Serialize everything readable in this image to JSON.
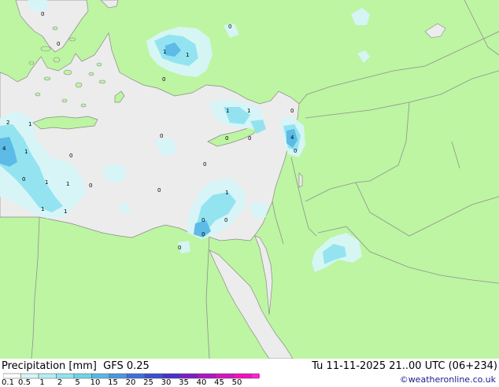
{
  "title": {
    "variable": "Precipitation [mm]",
    "model": "GFS 0.25",
    "valid_time": "Tu 11-11-2025 21..00 UTC (06+234)"
  },
  "credit": "©weatheronline.co.uk",
  "legend": {
    "ticks": [
      "0.1",
      "0.5",
      "1",
      "2",
      "5",
      "10",
      "15",
      "20",
      "25",
      "30",
      "35",
      "40",
      "45",
      "50"
    ],
    "colors": [
      "#ffffff",
      "#d6f5f8",
      "#b4eef5",
      "#8fe3ef",
      "#6fd3ea",
      "#58b8e6",
      "#4a96e0",
      "#3f6fd8",
      "#3a4fd0",
      "#4a2fc9",
      "#7a1fc5",
      "#a918c2",
      "#d214c0",
      "#f10fbf",
      "#ff1fd8"
    ]
  },
  "map_colors": {
    "land": "#bdf5a3",
    "sea": "#ececec",
    "border": "#909090"
  },
  "points": [
    {
      "id": "p1",
      "v": "0"
    },
    {
      "id": "p2",
      "v": "0"
    },
    {
      "id": "p3",
      "v": "0"
    },
    {
      "id": "p4",
      "v": "1"
    },
    {
      "id": "p5",
      "v": "1"
    },
    {
      "id": "p6",
      "v": "0"
    },
    {
      "id": "p7",
      "v": "2"
    },
    {
      "id": "p8",
      "v": "1"
    },
    {
      "id": "p9",
      "v": "4"
    },
    {
      "id": "p10",
      "v": "1"
    },
    {
      "id": "p11",
      "v": "0"
    },
    {
      "id": "p12",
      "v": "0"
    },
    {
      "id": "p13",
      "v": "1"
    },
    {
      "id": "p14",
      "v": "1"
    },
    {
      "id": "p15",
      "v": "0"
    },
    {
      "id": "p16",
      "v": "1"
    },
    {
      "id": "p17",
      "v": "1"
    },
    {
      "id": "p18",
      "v": "0"
    },
    {
      "id": "p19",
      "v": "1"
    },
    {
      "id": "p20",
      "v": "1"
    },
    {
      "id": "p21",
      "v": "0"
    },
    {
      "id": "p22",
      "v": "0"
    },
    {
      "id": "p23",
      "v": "0"
    },
    {
      "id": "p24",
      "v": "0"
    },
    {
      "id": "p25",
      "v": "0"
    },
    {
      "id": "p26",
      "v": "0"
    },
    {
      "id": "p27",
      "v": "4"
    },
    {
      "id": "p28",
      "v": "1"
    },
    {
      "id": "p29",
      "v": "0"
    },
    {
      "id": "p30",
      "v": "0"
    },
    {
      "id": "p31",
      "v": "0"
    },
    {
      "id": "p32",
      "v": "0"
    }
  ]
}
